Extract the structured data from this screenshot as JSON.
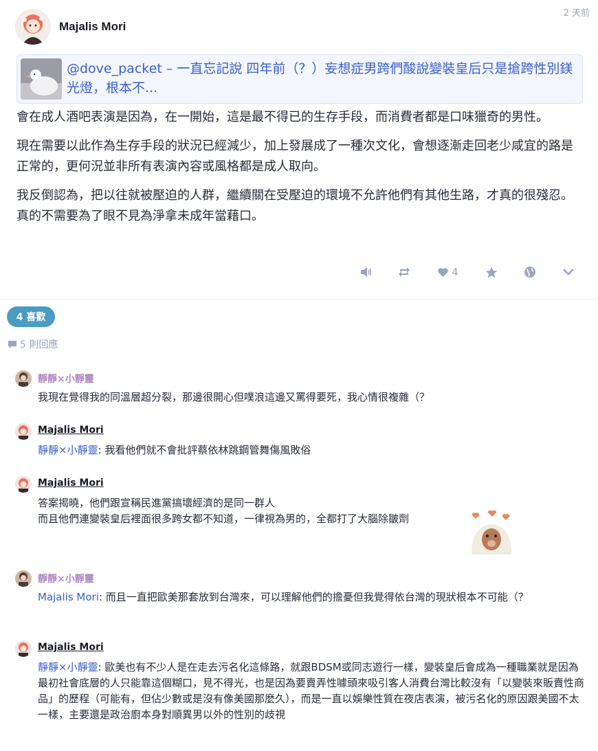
{
  "post": {
    "author": "Majalis Mori",
    "time": "2 天前",
    "quote": {
      "text": "@dove_packet – 一直忘記說 四年前（？）妄想症男跨們酸說變裝皇后只是搶跨性別鎂光燈，根本不..."
    },
    "paragraphs": [
      "會在成人酒吧表演是因為，在一開始，這是最不得已的生存手段，而消費者都是口味獵奇的男性。",
      "現在需要以此作為生存手段的狀況已經減少，加上發展成了一種次文化，會想逐漸走回老少咸宜的路是正常的，更何況並非所有表演內容或風格都是成人取向。",
      "我反倒認為，把以往就被壓迫的人群，繼續關在受壓迫的環境不允許他們有其他生路，才真的很殘忍。真的不需要為了眼不見為淨拿未成年當藉口。"
    ],
    "actions": {
      "like_count": "4"
    }
  },
  "likes_label": "4 喜歡",
  "replies_label": "5 則回應",
  "comments": [
    {
      "author": "靜靜×小靜靈",
      "mention": "",
      "lines": [
        "我現在覺得我的同溫層超分裂，那邊很開心但噗浪這邊又罵得要死，我心情很複雜（？"
      ]
    },
    {
      "author": "Majalis Mori",
      "mention": "靜靜×小靜靈",
      "lines": [
        ": 我看他們就不會批評蔡依林跳鋼管舞傷風敗俗"
      ]
    },
    {
      "author": "Majalis Mori",
      "mention": "",
      "lines": [
        "答案揭曉，他們跟宣稱民進黨搞壞經濟的是同一群人",
        "而且他們連變裝皇后裡面很多跨女都不知道，一律視為男的，全都打了大腦除皺劑"
      ]
    },
    {
      "author": "靜靜×小靜靈",
      "mention": "Majalis Mori",
      "lines": [
        ": 而且一直把歐美那套放到台灣來，可以理解他們的擔憂但我覺得依台灣的現狀根本不可能（？"
      ]
    },
    {
      "author": "Majalis Mori",
      "mention": "靜靜×小靜靈",
      "lines": [
        ": 歐美也有不少人是在走去污名化這條路，就跟BDSM或同志遊行一樣，變裝皇后會成為一種職業就是因為最初社會底層的人只能靠這個糊口，見不得光，也是因為要賣弄性噱頭來吸引客人消費台灣比較沒有「以變裝來販賣性商品」的歷程（可能有，但佔少數或是沒有像美國那麼久），而是一直以娛樂性質在夜店表演，被污名化的原因跟美國不太一樣，主要還是政治廚本身對順異男以外的性別的歧視"
      ]
    }
  ]
}
